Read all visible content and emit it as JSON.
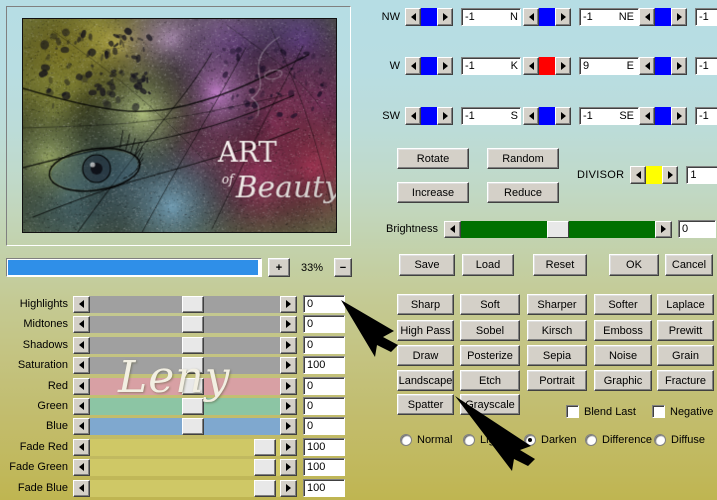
{
  "preview": {
    "zoom_label": "33%",
    "plus_label": "+",
    "minus_label": "−",
    "artwork_title": "ART",
    "artwork_sub_of": "of",
    "artwork_sub": "Beauty",
    "watermark": "Leny"
  },
  "matrix": {
    "cells": [
      {
        "label": "NW",
        "value": "-1",
        "thumb_color": "#0000ff"
      },
      {
        "label": "N",
        "value": "-1",
        "thumb_color": "#0000ff"
      },
      {
        "label": "NE",
        "value": "-1",
        "thumb_color": "#0000ff"
      },
      {
        "label": "W",
        "value": "-1",
        "thumb_color": "#0000ff"
      },
      {
        "label": "K",
        "value": "9",
        "thumb_color": "#ff0000"
      },
      {
        "label": "E",
        "value": "-1",
        "thumb_color": "#0000ff"
      },
      {
        "label": "SW",
        "value": "-1",
        "thumb_color": "#0000ff"
      },
      {
        "label": "S",
        "value": "-1",
        "thumb_color": "#0000ff"
      },
      {
        "label": "SE",
        "value": "-1",
        "thumb_color": "#0000ff"
      }
    ]
  },
  "matrix_ops": {
    "rotate": "Rotate",
    "random": "Random",
    "increase": "Increase",
    "reduce": "Reduce"
  },
  "divisor": {
    "label": "DIVISOR",
    "value": "1",
    "thumb_color": "#ffff00"
  },
  "brightness": {
    "label": "Brightness",
    "value": "0",
    "track_color": "#007000"
  },
  "dialog_buttons": {
    "save": "Save",
    "load": "Load",
    "reset": "Reset",
    "ok": "OK",
    "cancel": "Cancel"
  },
  "adjust_sliders": [
    {
      "label": "Highlights",
      "value": "0",
      "track_color": "#a0a0a0",
      "thumb_pct": 54
    },
    {
      "label": "Midtones",
      "value": "0",
      "track_color": "#a0a0a0",
      "thumb_pct": 54
    },
    {
      "label": "Shadows",
      "value": "0",
      "track_color": "#a0a0a0",
      "thumb_pct": 54
    },
    {
      "label": "Saturation",
      "value": "100",
      "track_color": "#a0a0a0",
      "thumb_pct": 54
    },
    {
      "label": "Red",
      "value": "0",
      "track_color": "#d8a0a4",
      "thumb_pct": 54
    },
    {
      "label": "Green",
      "value": "0",
      "track_color": "#8cc5a4",
      "thumb_pct": 54
    },
    {
      "label": "Blue",
      "value": "0",
      "track_color": "#7fa8cf",
      "thumb_pct": 54
    },
    {
      "label": "Fade Red",
      "value": "100",
      "track_color": "#cfc866",
      "thumb_pct": 92
    },
    {
      "label": "Fade Green",
      "value": "100",
      "track_color": "#cfc866",
      "thumb_pct": 92
    },
    {
      "label": "Fade Blue",
      "value": "100",
      "track_color": "#cfc866",
      "thumb_pct": 92
    }
  ],
  "filters": {
    "rows": [
      [
        "Sharp",
        "Soft",
        "Sharper",
        "Softer",
        "Laplace"
      ],
      [
        "High Pass",
        "Sobel",
        "Kirsch",
        "Emboss",
        "Prewitt"
      ],
      [
        "Draw",
        "Posterize",
        "Sepia",
        "Noise",
        "Grain"
      ],
      [
        "Landscape",
        "Etch",
        "Portrait",
        "Graphic",
        "Fracture"
      ],
      [
        "Spatter",
        "Grayscale"
      ]
    ]
  },
  "checkboxes": [
    {
      "label": "Blend Last",
      "checked": false
    },
    {
      "label": "Negative",
      "checked": false
    }
  ],
  "blend_modes": {
    "options": [
      "Normal",
      "Lighten",
      "Darken",
      "Difference",
      "Diffuse"
    ],
    "selected": "Darken"
  }
}
